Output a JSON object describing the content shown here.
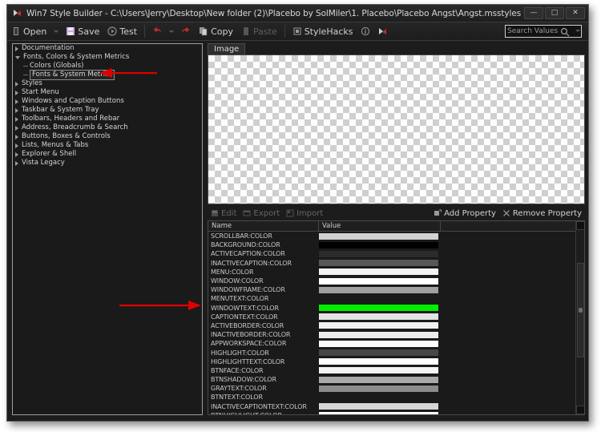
{
  "window": {
    "title": "Win7 Style Builder - C:\\Users\\Jerry\\Desktop\\New folder (2)\\Placebo by SolMiler\\1. Placebo\\Placebo Angst\\Angst.msstyles *",
    "icon": "app-logo-icon",
    "minimize_label": "—",
    "maximize_label": "□",
    "close_label": "✕"
  },
  "toolbar": {
    "open_label": "Open",
    "save_label": "Save",
    "test_label": "Test",
    "copy_label": "Copy",
    "paste_label": "Paste",
    "stylehacks_label": "StyleHacks",
    "search": {
      "value": "Search Values",
      "placeholder": "Search Values"
    }
  },
  "tree": {
    "items": [
      {
        "label": "Documentation",
        "depth": 0,
        "state": "collapsed",
        "selected": false
      },
      {
        "label": "Fonts, Colors & System Metrics",
        "depth": 0,
        "state": "expanded",
        "selected": false
      },
      {
        "label": "Colors (Globals)",
        "depth": 1,
        "state": "leaf",
        "selected": false
      },
      {
        "label": "Fonts & System Metrics",
        "depth": 1,
        "state": "leaf",
        "selected": true
      },
      {
        "label": "Styles",
        "depth": 0,
        "state": "collapsed",
        "selected": false
      },
      {
        "label": "Start Menu",
        "depth": 0,
        "state": "collapsed",
        "selected": false
      },
      {
        "label": "Windows and Caption Buttons",
        "depth": 0,
        "state": "collapsed",
        "selected": false
      },
      {
        "label": "Taskbar & System Tray",
        "depth": 0,
        "state": "collapsed",
        "selected": false
      },
      {
        "label": "Toolbars, Headers and Rebar",
        "depth": 0,
        "state": "collapsed",
        "selected": false
      },
      {
        "label": "Address, Breadcrumb & Search",
        "depth": 0,
        "state": "collapsed",
        "selected": false
      },
      {
        "label": "Buttons, Boxes & Controls",
        "depth": 0,
        "state": "collapsed",
        "selected": false
      },
      {
        "label": "Lists, Menus & Tabs",
        "depth": 0,
        "state": "collapsed",
        "selected": false
      },
      {
        "label": "Explorer & Shell",
        "depth": 0,
        "state": "collapsed",
        "selected": false
      },
      {
        "label": "Vista Legacy",
        "depth": 0,
        "state": "collapsed",
        "selected": false
      }
    ]
  },
  "image_panel": {
    "tab_label": "Image",
    "canvas_state": "empty-transparent-checkerboard"
  },
  "property_actions": {
    "edit_label": "Edit",
    "export_label": "Export",
    "import_label": "Import",
    "add_property_label": "Add Property",
    "remove_property_label": "Remove Property"
  },
  "property_grid": {
    "columns": [
      "Name",
      "Value"
    ],
    "rows": [
      {
        "name": "SCROLLBAR:COLOR",
        "color": "#d2d2d2"
      },
      {
        "name": "BACKGROUND:COLOR",
        "color": "#000000"
      },
      {
        "name": "ACTIVECAPTION:COLOR",
        "color": "#2b2b2b"
      },
      {
        "name": "INACTIVECAPTION:COLOR",
        "color": "#575757"
      },
      {
        "name": "MENU:COLOR",
        "color": "#f1f1f1"
      },
      {
        "name": "WINDOW:COLOR",
        "color": "#ffffff"
      },
      {
        "name": "WINDOWFRAME:COLOR",
        "color": "#a0a0a0"
      },
      {
        "name": "MENUTEXT:COLOR",
        "color": ""
      },
      {
        "name": "WINDOWTEXT:COLOR",
        "color": "#00ef00"
      },
      {
        "name": "CAPTIONTEXT:COLOR",
        "color": "#e3e3e3"
      },
      {
        "name": "ACTIVEBORDER:COLOR",
        "color": "#f0f0f0"
      },
      {
        "name": "INACTIVEBORDER:COLOR",
        "color": "#ededed"
      },
      {
        "name": "APPWORKSPACE:COLOR",
        "color": "#fafafa"
      },
      {
        "name": "HIGHLIGHT:COLOR",
        "color": "#474747"
      },
      {
        "name": "HIGHLIGHTTEXT:COLOR",
        "color": "#ffffff"
      },
      {
        "name": "BTNFACE:COLOR",
        "color": "#f4f4f4"
      },
      {
        "name": "BTNSHADOW:COLOR",
        "color": "#a9a9a9"
      },
      {
        "name": "GRAYTEXT:COLOR",
        "color": "#8c8c8c"
      },
      {
        "name": "BTNTEXT:COLOR",
        "color": ""
      },
      {
        "name": "INACTIVECAPTIONTEXT:COLOR",
        "color": "#d6d6d6"
      },
      {
        "name": "BTNHIGHLIGHT:COLOR",
        "color": "#fbfbfb"
      }
    ]
  },
  "annotations": [
    {
      "name": "arrow-to-fonts-system-metrics",
      "direction": "left",
      "target": "Fonts & System Metrics",
      "color": "#e00000"
    },
    {
      "name": "arrow-to-windowtext-color",
      "direction": "right",
      "target": "WINDOWTEXT:COLOR",
      "color": "#e00000"
    }
  ]
}
